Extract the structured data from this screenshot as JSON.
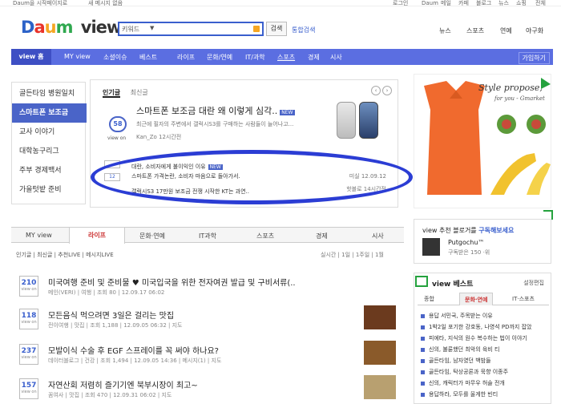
{
  "topbar": {
    "left": "Daum을 시작페이지로",
    "notice": "새 메시지 없음",
    "right_items": [
      "로그인",
      "Daum",
      "메일",
      "카페",
      "블로그",
      "뉴스",
      "쇼핑",
      "전체"
    ]
  },
  "header": {
    "logo_parts": [
      "D",
      "a",
      "u",
      "m"
    ],
    "logo_suffix": "view",
    "search": {
      "select": "키워드",
      "placeholder": ""
    },
    "search_button": "검색",
    "total_search": "통합검색",
    "links": [
      "뉴스",
      "스포츠",
      "연예",
      "야구화"
    ]
  },
  "nav": {
    "home": "view 홈",
    "items": [
      "MY view",
      "소셜이슈",
      "베스트",
      "라이프",
      "문화/연예",
      "IT/과학",
      "스포츠",
      "경제",
      "시사"
    ],
    "join": "가입하기"
  },
  "left_menu": [
    "골든타임 병원일치",
    "스마트폰 보조금",
    "교사 이야기",
    "대학농구리그",
    "주부 경제백서",
    "가을텃밭 준비"
  ],
  "feature": {
    "tabs": [
      "인기글",
      "최신글"
    ],
    "count": "58",
    "count_label": "view on",
    "title": "스마트폰 보조금 대란 왜 이렇게 심각..",
    "badge": "NEW",
    "desc": "최근에 필자의 주변에서 갤럭시S3를 구매하는 사람들이 늘어나고...",
    "meta": "Kan_Zo  12시간전",
    "rows": [
      {
        "n": "",
        "t": "대란, 소비자에게 불이익인 이유",
        "badge": "NEW",
        "r": ""
      },
      {
        "n": "12",
        "t": "스마트폰 가격논란, 소비자 마음으로 돌아가서.",
        "r": "미실  12.09.12"
      },
      {
        "n": "",
        "t": "갤럭시S3 17만원 보조금 전쟁 시작한 KT는 과연..",
        "r": "핫블로  14시간전"
      }
    ]
  },
  "ad": {
    "brand": "Style propose,",
    "sub": "for you - Gmarket"
  },
  "bottom_tabs": [
    "MY view",
    "라이프",
    "문화·연예",
    "IT과학",
    "스포츠",
    "경제",
    "시사"
  ],
  "subtabs": "인기글 | 최신글 | 추천LIVE | 메시지LIVE",
  "subright": "실시간 | 1일 | 1주일 | 1월",
  "posts": [
    {
      "cnt": "210",
      "t": "미국여행 준비 및 준비물 ♥ 미국입국을 위한 전자여권 발급 및 구비서류(..",
      "m": "메인(VERI) | 여행 | 조회 80 | 12.09.17 06:02",
      "thumb": ""
    },
    {
      "cnt": "118",
      "t": "모든음식 먹으려면 3일은 걸리는 맛집",
      "m": "전이여행 | 맛집 | 조회 1,188 | 12.09.05 06:32 | 지도",
      "thumb": "#6b3a1e"
    },
    {
      "cnt": "237",
      "t": "모발이식 수술 후 EGF 스프레이를 꼭 써야 하나요?",
      "m": "데이터블로그 | 건강 | 조회 1,494 | 12.09.05 14:36 | 메시지(1) | 지도",
      "thumb": "#8a5a2a"
    },
    {
      "cnt": "157",
      "t": "자연산회 저렴히 즐기기엔 북부시장이 최고~",
      "m": "꼼여사 | 맛집 | 조회 470 | 12.09.31 06:02 | 지도",
      "thumb": "#b8a070"
    }
  ],
  "post_count_label": "view on",
  "subscribe": {
    "head_prefix": "view 추천 블로거를",
    "head_link": "구독해보세요",
    "name": "Putgochu™",
    "sub": "구독받은 150  ·위"
  },
  "best": {
    "title": "view 베스트",
    "config": "설정편집",
    "tabs": [
      "종합",
      "문화·연예",
      "IT·스포츠"
    ],
    "items": [
      "용답 서민국, 주목받는 이유",
      "1박2일 포기한 강호동, 나영석 PD까지 잡았",
      "피에타, 지식의 원수 복수하는 법이 이야기",
      "신의, 불륜했던 최악의 육비 티",
      "골든타임, 남자였던 백밤들",
      "골든타임, 탁상공론과 묵향 이종주",
      "신의, 캐릭터가 마무우 허술 전개",
      "용답하라, 모두를 울게한 빈티"
    ]
  },
  "colors": {
    "accent": "#4a64c8",
    "nav": "#5b6ee1",
    "ellipse": "#2b3dd4",
    "green": "#25a23e"
  }
}
